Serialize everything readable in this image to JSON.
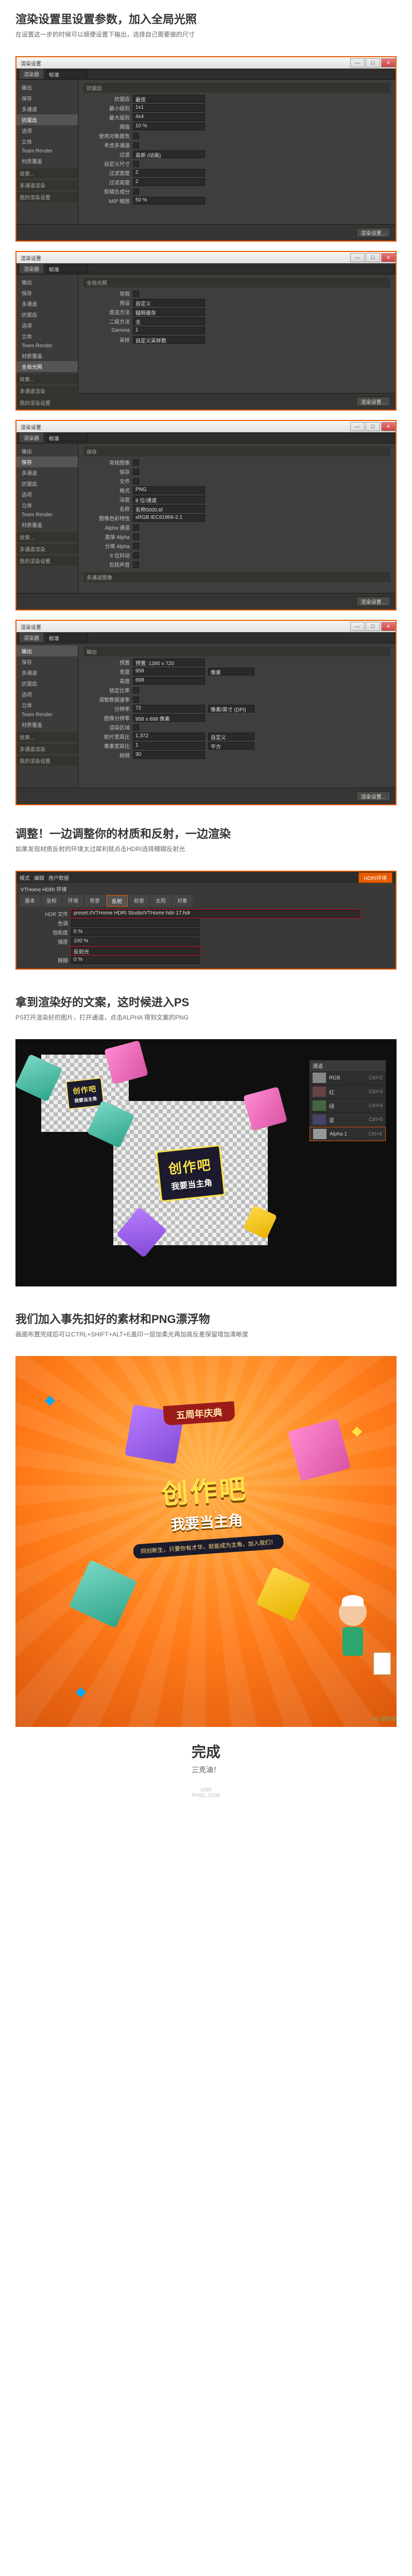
{
  "step1": {
    "heading": "渲染设置里设置参数，加入全局光照",
    "sub": "在设置这一步的时候可以顺便设置下输出，选择自己需要做的尺寸"
  },
  "window_title": "渲染设置",
  "win_buttons": {
    "min": "—",
    "max": "☐",
    "close": "✕"
  },
  "tool_tab": "渲染器",
  "render_dropdown": "标准",
  "sidebar": {
    "items": [
      "输出",
      "保存",
      "多通道",
      "抗锯齿",
      "选项",
      "立体",
      "Team Render",
      "材质覆盖"
    ],
    "groups": [
      "效果...",
      "多通道渲染",
      "我的渲染设置"
    ],
    "active_effect": "全局光照"
  },
  "form_aa": {
    "group": "抗锯齿",
    "rows": [
      {
        "label": "抗锯齿",
        "value": "最佳"
      },
      {
        "label": "最小级别",
        "value": "1x1"
      },
      {
        "label": "最大级别",
        "value": "4x4"
      },
      {
        "label": "阈值",
        "value": "10 %"
      },
      {
        "label": "使用对象属性",
        "value": ""
      },
      {
        "label": "考虑多通道",
        "value": ""
      },
      {
        "label": "过滤",
        "value": "高斯 (动画)"
      },
      {
        "label": "自定义尺寸",
        "value": ""
      },
      {
        "label": "过滤宽度",
        "value": "2"
      },
      {
        "label": "过滤高度",
        "value": "2"
      },
      {
        "label": "剪辑负成分",
        "value": ""
      },
      {
        "label": "MIP 缩放",
        "value": "50 %"
      }
    ]
  },
  "form_gi": {
    "group": "全局光照",
    "rows": [
      {
        "label": "常规",
        "value": ""
      },
      {
        "label": "预设",
        "value": "自定义"
      },
      {
        "label": "首选方法",
        "value": "辐照缓存"
      },
      {
        "label": "二级方法",
        "value": "无"
      },
      {
        "label": "Gamma",
        "value": "1"
      },
      {
        "label": "采样",
        "value": "自定义采样数"
      }
    ]
  },
  "form_save": {
    "group": "保存",
    "rows": [
      {
        "label": "常规图像",
        "value": ""
      },
      {
        "label": "保存",
        "value": ""
      },
      {
        "label": "文件",
        "value": ""
      },
      {
        "label": "格式",
        "value": "PNG"
      },
      {
        "label": "深度",
        "value": "8 位/通道"
      },
      {
        "label": "名称",
        "value": "名称0000.tif"
      },
      {
        "label": "图像色彩特性",
        "value": "sRGB IEC61966-2.1"
      },
      {
        "label": "Alpha 通道",
        "value": ""
      },
      {
        "label": "直接 Alpha",
        "value": ""
      },
      {
        "label": "分离 Alpha",
        "value": ""
      },
      {
        "label": "8 位抖动",
        "value": ""
      },
      {
        "label": "包括声音",
        "value": ""
      }
    ],
    "multi_group": "多通道图像"
  },
  "form_output": {
    "group": "输出",
    "rows": [
      {
        "label": "预置",
        "value": "预置: 1280 x 720"
      },
      {
        "label": "宽度",
        "value": "958",
        "unit": "像素"
      },
      {
        "label": "高度",
        "value": "698"
      },
      {
        "label": "锁定比率",
        "value": ""
      },
      {
        "label": "调整数据速率",
        "value": ""
      },
      {
        "label": "分辨率",
        "value": "72",
        "unit": "像素/英寸 (DPI)"
      },
      {
        "label": "图像分辨率",
        "value": "958 x 698 像素"
      },
      {
        "label": "渲染区域",
        "value": ""
      },
      {
        "label": "胶片宽高比",
        "value": "1.372",
        "unit": "自定义"
      },
      {
        "label": "像素宽高比",
        "value": "1",
        "unit": "平方"
      },
      {
        "label": "帧频",
        "value": "30"
      }
    ]
  },
  "footer_buttons": {
    "ok": "渲染设置..."
  },
  "step2": {
    "heading": "调整！一边调整你的材质和反射，一边渲染",
    "sub": "如果发现材质反射的环境太过犀利就点击HDRI选择模糊反射光"
  },
  "hdri": {
    "top_menu": [
      "模式",
      "编辑",
      "用户数据"
    ],
    "dropdown": "HDRI环境",
    "title": "VTHome HDRI 环境",
    "tabs": [
      "基本",
      "坐标",
      "环境",
      "背景",
      "反射",
      "前景",
      "太阳",
      "对象"
    ],
    "active_tab": "反射",
    "rows": [
      {
        "label": "HDR 文件",
        "value": "preset://VTHome HDRI Studio/VTHome hdri 17.hdr"
      },
      {
        "label": "色调",
        "value": ""
      },
      {
        "label": "饱和度",
        "value": "0 %"
      },
      {
        "label": "强度",
        "value": "100 %"
      },
      {
        "label": "",
        "value": "反射光"
      },
      {
        "label": "模糊",
        "value": "0 %"
      }
    ]
  },
  "step3": {
    "heading": "拿到渲染好的文案，这时候进入PS",
    "sub": "PS打开渲染好的图片，打开通道，点击ALPHA 得到文案的PNG"
  },
  "channels": {
    "head": "通道",
    "rows": [
      "RGB",
      "红",
      "绿",
      "蓝",
      "Alpha 1"
    ],
    "shortcut": [
      "Ctrl+2",
      "Ctrl+3",
      "Ctrl+4",
      "Ctrl+5",
      "Ctrl+6"
    ]
  },
  "art_text": {
    "line1": "创作吧",
    "line2": "我要当主角"
  },
  "step4": {
    "heading": "我们加入事先扣好的素材和PNG漂浮物",
    "sub": "画面布置完成后可以CTRL+SHIFT+ALT+E盖印一层加柔光再加高反差保留增加清晰度"
  },
  "poster": {
    "banner": "五周年庆典",
    "title": "创作吧",
    "sub": "我要当主角",
    "tagline": "同创新生，只要你有才华，就能成为主角，加入我们！"
  },
  "final": {
    "heading": "完成",
    "sub": "三克油！"
  },
  "footer": {
    "site1": "UI95",
    "site2": "PIXEL.COM"
  },
  "watermark": "PS 爱好者"
}
